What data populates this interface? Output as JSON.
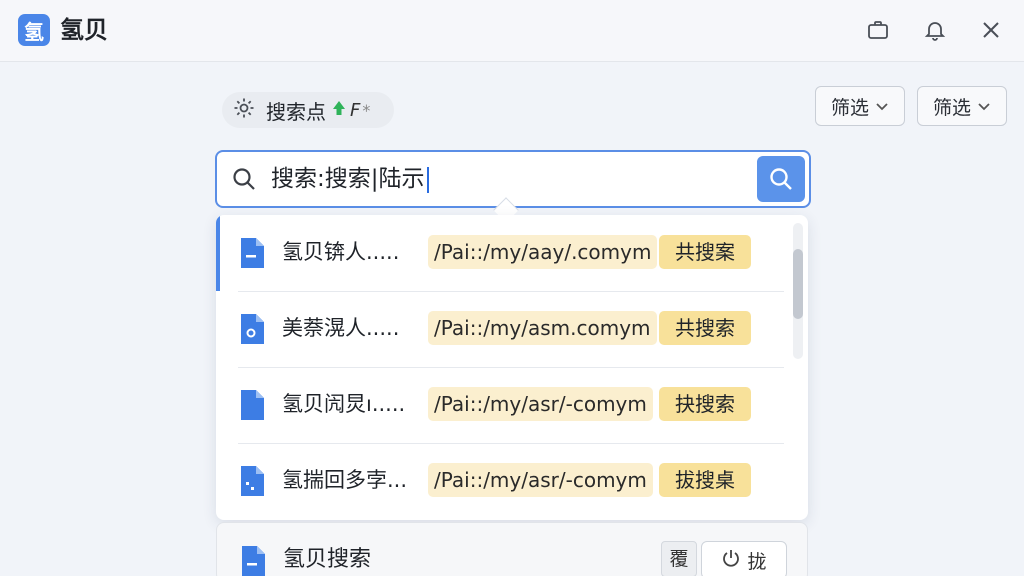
{
  "app": {
    "logo_glyph": "氢",
    "title": "氢贝"
  },
  "titlebar": {
    "icons": [
      "briefcase-icon",
      "bell-icon",
      "close-icon"
    ]
  },
  "chip": {
    "label": "搜索点",
    "suffix": "F",
    "star": "*"
  },
  "filters": [
    {
      "label": "筛选"
    },
    {
      "label": "筛选"
    }
  ],
  "search": {
    "value": "搜索:搜索|陆示"
  },
  "results": [
    {
      "title": "氢贝锛人.....",
      "path": "/Pai::/my/aay/.comym",
      "tag": "共搜案"
    },
    {
      "title": "美萘滉人.....",
      "path": "/Pai::/my/asm.comym",
      "tag": "共搜索"
    },
    {
      "title": "氢贝闶炅ı.....",
      "path": "/Pai::/my/asr/-comym",
      "tag": "抉搜索"
    },
    {
      "title": "氢揣回多孛...",
      "path": "/Pai::/my/asr/-comym",
      "tag": "拔搜桌"
    }
  ],
  "footer": {
    "title": "氢贝搜索",
    "mini_label": "覆",
    "button_label": "拢"
  },
  "colors": {
    "accent": "#4a86e8",
    "path_bg": "#fbefcf",
    "tag_bg": "#f8e19a",
    "green_up": "#2fb35a"
  }
}
